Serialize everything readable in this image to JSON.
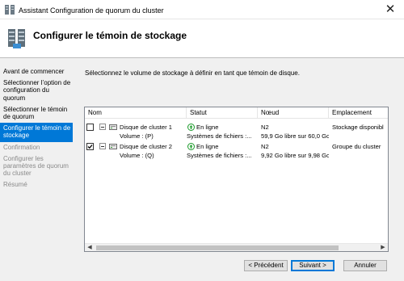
{
  "window": {
    "title": "Assistant Configuration de quorum du cluster",
    "close_glyph": "✕"
  },
  "header": {
    "title": "Configurer le témoin de stockage"
  },
  "nav": {
    "items": [
      {
        "label": "Avant de commencer",
        "state": "normal"
      },
      {
        "label": "Sélectionner l’option de configuration du quorum",
        "state": "normal"
      },
      {
        "label": "Sélectionner le témoin de quorum",
        "state": "normal"
      },
      {
        "label": "Configurer le témoin de stockage",
        "state": "active"
      },
      {
        "label": "Confirmation",
        "state": "disabled"
      },
      {
        "label": "Configurer les paramètres de quorum du cluster",
        "state": "disabled"
      },
      {
        "label": "Résumé",
        "state": "disabled"
      }
    ]
  },
  "main": {
    "instruction": "Sélectionnez le volume de stockage à définir en tant que témoin de disque.",
    "table": {
      "columns": [
        "Nom",
        "Statut",
        "Nœud",
        "Emplacement"
      ],
      "rows": [
        {
          "checked": false,
          "name": "Disque de cluster 1",
          "status": "En ligne",
          "node": "N2",
          "location": "Stockage disponibl",
          "volume": {
            "name": "Volume : (P)",
            "fs": "Systèmes de fichiers :...",
            "free": "59,9 Go libre sur 60,0 Go"
          }
        },
        {
          "checked": true,
          "name": "Disque de cluster 2",
          "status": "En ligne",
          "node": "N2",
          "location": "Groupe du cluster",
          "volume": {
            "name": "Volume : (Q)",
            "fs": "Systèmes de fichiers :...",
            "free": "9,92 Go libre sur 9,98 Go"
          }
        }
      ]
    }
  },
  "buttons": {
    "previous": "< Précédent",
    "next": "Suivant >",
    "cancel": "Annuler"
  },
  "colors": {
    "accent": "#0078d7",
    "status_ok": "#1a9a2a",
    "panel_bg": "#f0f0f0"
  },
  "icons": {
    "app": "cluster-wizard-icon",
    "header": "server-storage-icon",
    "disk": "disk-icon",
    "status": "online-arrow-icon"
  }
}
